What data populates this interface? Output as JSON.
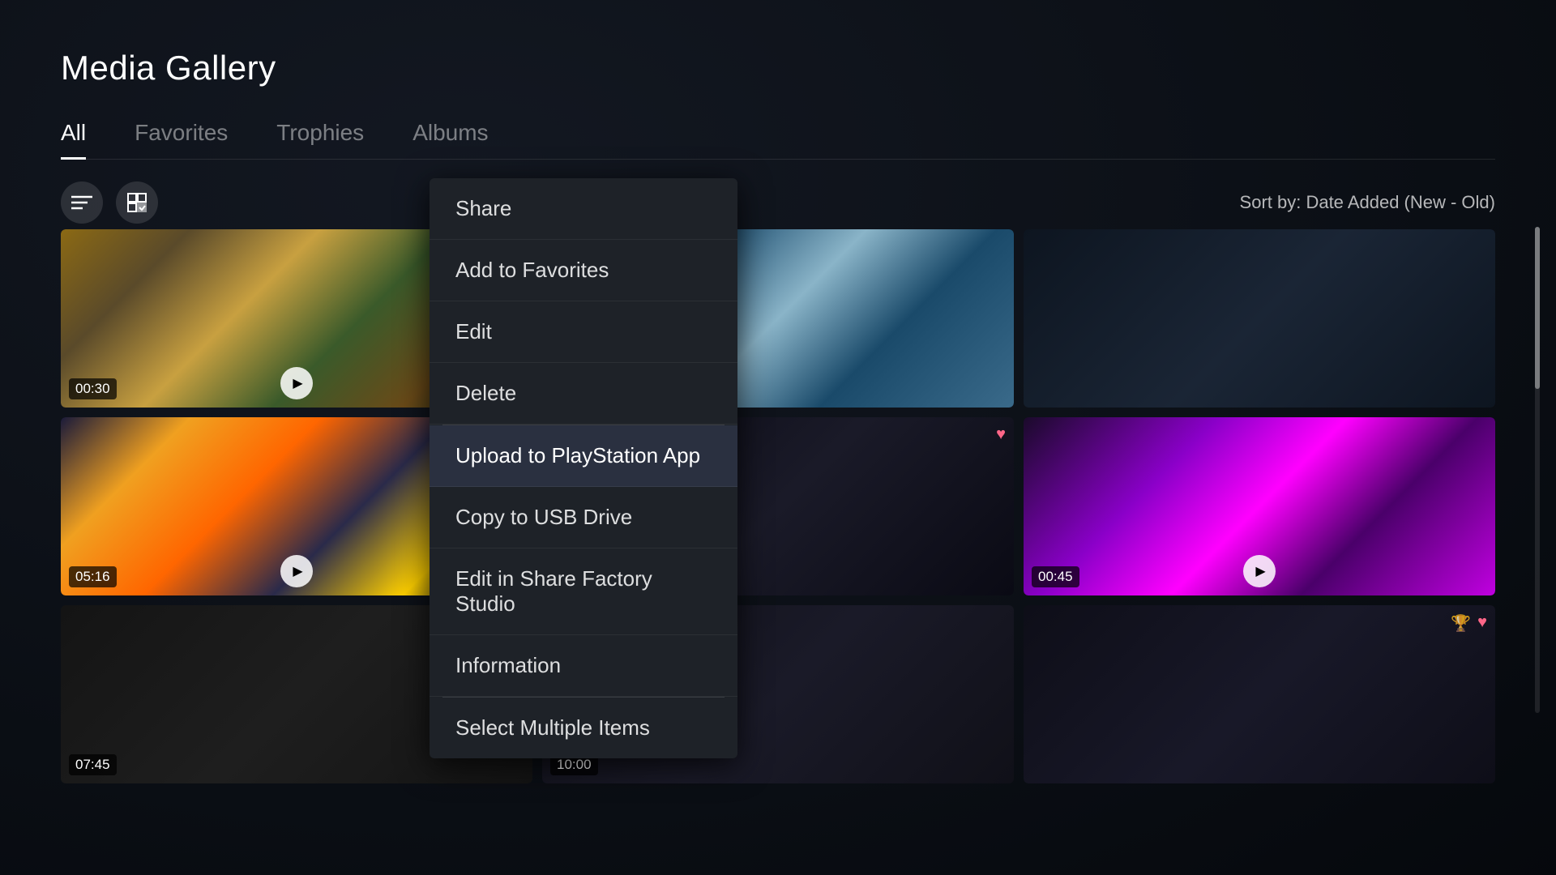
{
  "page": {
    "title": "Media Gallery"
  },
  "tabs": [
    {
      "label": "All",
      "active": true
    },
    {
      "label": "Favorites",
      "active": false
    },
    {
      "label": "Trophies",
      "active": false
    },
    {
      "label": "Albums",
      "active": false
    }
  ],
  "toolbar": {
    "sort_label": "Sort by: Date Added (New - Old)"
  },
  "media_items": [
    {
      "id": 1,
      "duration": "00:30",
      "has_trophy": true,
      "has_heart": false,
      "has_play": true,
      "thumb_class": "thumb-aloy"
    },
    {
      "id": 2,
      "duration": "",
      "has_trophy": false,
      "has_heart": false,
      "has_play": false,
      "thumb_class": "thumb-horizon-far"
    },
    {
      "id": 3,
      "duration": "",
      "has_trophy": false,
      "has_heart": false,
      "has_play": false,
      "thumb_class": "thumb-dark1"
    },
    {
      "id": 4,
      "duration": "05:16",
      "has_trophy": true,
      "has_heart": true,
      "has_play": true,
      "thumb_class": "thumb-ratchet1"
    },
    {
      "id": 5,
      "duration": "",
      "has_trophy": false,
      "has_heart": true,
      "has_play": false,
      "thumb_class": "thumb-dark2"
    },
    {
      "id": 6,
      "duration": "00:45",
      "has_trophy": false,
      "has_heart": false,
      "has_play": true,
      "thumb_class": "thumb-ratchet2"
    },
    {
      "id": 7,
      "duration": "07:45",
      "has_trophy": false,
      "has_heart": false,
      "has_play": false,
      "thumb_class": "thumb-dark3"
    },
    {
      "id": 8,
      "duration": "10:00",
      "has_trophy": false,
      "has_heart": false,
      "has_play": false,
      "thumb_class": "thumb-dark3"
    },
    {
      "id": 9,
      "duration": "",
      "has_trophy": true,
      "has_heart": true,
      "has_play": false,
      "thumb_class": "thumb-dark1"
    }
  ],
  "context_menu": {
    "items": [
      {
        "label": "Share",
        "highlighted": false,
        "divider_after": false
      },
      {
        "label": "Add to Favorites",
        "highlighted": false,
        "divider_after": false
      },
      {
        "label": "Edit",
        "highlighted": false,
        "divider_after": false
      },
      {
        "label": "Delete",
        "highlighted": false,
        "divider_after": true
      },
      {
        "label": "Upload to PlayStation App",
        "highlighted": true,
        "divider_after": false
      },
      {
        "label": "Copy to USB Drive",
        "highlighted": false,
        "divider_after": false
      },
      {
        "label": "Edit in Share Factory Studio",
        "highlighted": false,
        "divider_after": false
      },
      {
        "label": "Information",
        "highlighted": false,
        "divider_after": true
      },
      {
        "label": "Select Multiple Items",
        "highlighted": false,
        "divider_after": false
      }
    ]
  }
}
